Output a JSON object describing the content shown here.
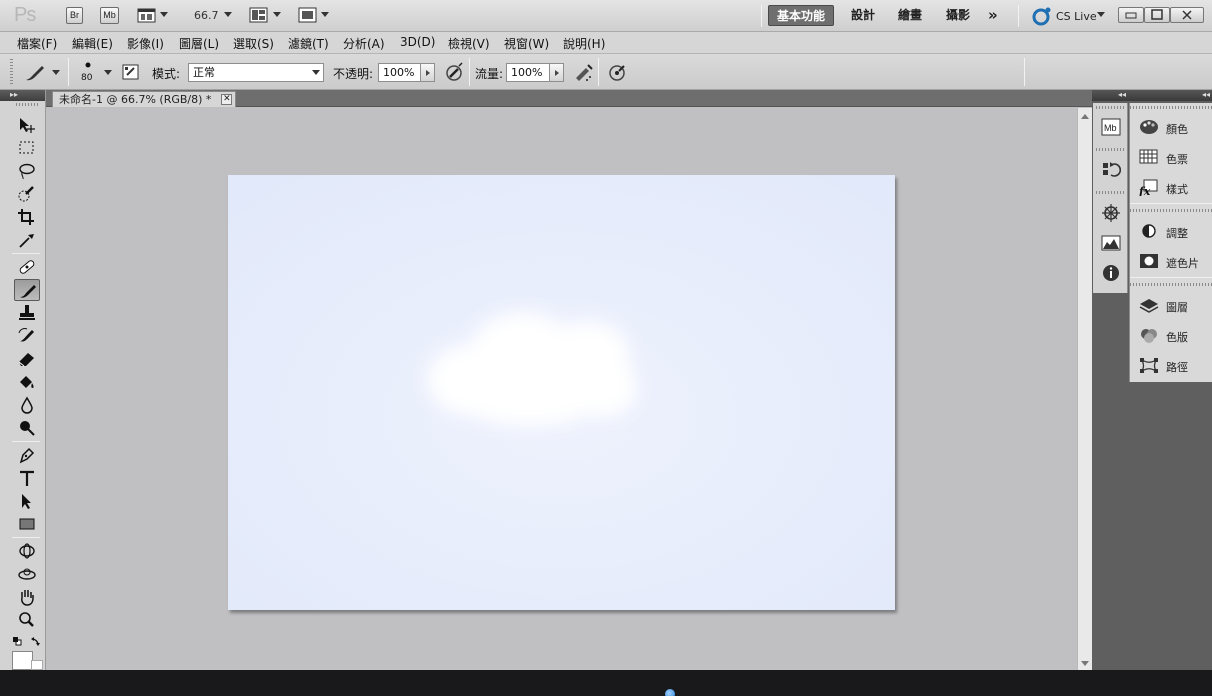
{
  "app": {
    "logo": "Ps",
    "bridge_icon": "Br",
    "minibridge_icon": "Mb",
    "zoom_level": "66.7",
    "workspaces": [
      "基本功能",
      "設計",
      "繪畫",
      "攝影"
    ],
    "more_workspaces": "»",
    "cs_live": "CS Live"
  },
  "menu": [
    "檔案(F)",
    "編輯(E)",
    "影像(I)",
    "圖層(L)",
    "選取(S)",
    "濾鏡(T)",
    "分析(A)",
    "3D(D)",
    "檢視(V)",
    "視窗(W)",
    "說明(H)"
  ],
  "options": {
    "brush_size": "80",
    "mode_label": "模式:",
    "mode_value": "正常",
    "opacity_label": "不透明:",
    "opacity_value": "100%",
    "flow_label": "流量:",
    "flow_value": "100%"
  },
  "document": {
    "tab_title": "未命名-1 @ 66.7% (RGB/8) *",
    "tab_close": "✕",
    "canvas_color": "#e5ebfb"
  },
  "tools": [
    "move",
    "marquee",
    "lasso",
    "quick-selection",
    "crop",
    "eyedropper",
    "spot-healing",
    "brush",
    "clone-stamp",
    "history-brush",
    "eraser",
    "paint-bucket",
    "blur",
    "dodge",
    "pen",
    "type",
    "path-selection",
    "rectangle",
    "3d-rotate",
    "3d-orbit",
    "hand",
    "zoom"
  ],
  "active_tool": "brush",
  "panels": {
    "group1": [
      "顏色",
      "色票",
      "樣式"
    ],
    "group2": [
      "調整",
      "遮色片"
    ],
    "group3": [
      "圖層",
      "色版",
      "路徑"
    ]
  },
  "colors": {
    "accent_workspace": "#6f6f6f",
    "foreground": "#000000",
    "background": "#ffffff"
  }
}
